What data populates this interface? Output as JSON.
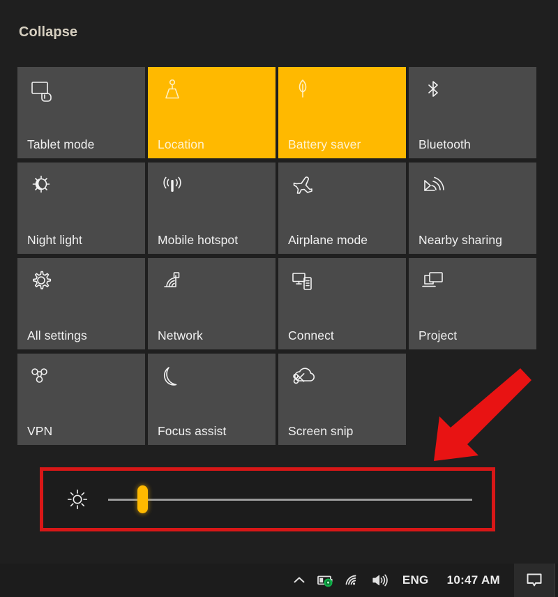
{
  "panel": {
    "collapse_label": "Collapse",
    "background_color": "#1f1f1f",
    "tile_inactive_color": "#4a4a4a",
    "tile_active_color": "#ffb900"
  },
  "tiles": [
    {
      "label": "Tablet mode",
      "icon": "tablet-mode-icon",
      "active": false
    },
    {
      "label": "Location",
      "icon": "location-icon",
      "active": true
    },
    {
      "label": "Battery saver",
      "icon": "battery-saver-icon",
      "active": true
    },
    {
      "label": "Bluetooth",
      "icon": "bluetooth-icon",
      "active": false
    },
    {
      "label": "Night light",
      "icon": "night-light-icon",
      "active": false
    },
    {
      "label": "Mobile hotspot",
      "icon": "mobile-hotspot-icon",
      "active": false
    },
    {
      "label": "Airplane mode",
      "icon": "airplane-mode-icon",
      "active": false
    },
    {
      "label": "Nearby sharing",
      "icon": "nearby-sharing-icon",
      "active": false
    },
    {
      "label": "All settings",
      "icon": "gear-icon",
      "active": false
    },
    {
      "label": "Network",
      "icon": "network-icon",
      "active": false
    },
    {
      "label": "Connect",
      "icon": "connect-icon",
      "active": false
    },
    {
      "label": "Project",
      "icon": "project-icon",
      "active": false
    },
    {
      "label": "VPN",
      "icon": "vpn-icon",
      "active": false
    },
    {
      "label": "Focus assist",
      "icon": "moon-icon",
      "active": false
    },
    {
      "label": "Screen snip",
      "icon": "screen-snip-icon",
      "active": false
    }
  ],
  "brightness": {
    "icon": "brightness-icon",
    "value_percent": 8,
    "thumb_color": "#ffb900",
    "track_color": "#9a9a9a",
    "highlight_border_color": "#d81717"
  },
  "annotation": {
    "arrow_color": "#e81313",
    "points_to": "brightness-slider"
  },
  "taskbar": {
    "items": [
      {
        "name": "show-hidden-icons-chevron",
        "icon": "chevron-up-icon"
      },
      {
        "name": "battery-security-icon",
        "icon": "battery-shield-icon"
      },
      {
        "name": "network-wifi-icon",
        "icon": "wifi-icon"
      },
      {
        "name": "volume-icon",
        "icon": "speaker-icon"
      }
    ],
    "language": "ENG",
    "clock": "10:47 AM",
    "action_center": {
      "icon": "action-center-icon",
      "label": "Action Center"
    }
  }
}
